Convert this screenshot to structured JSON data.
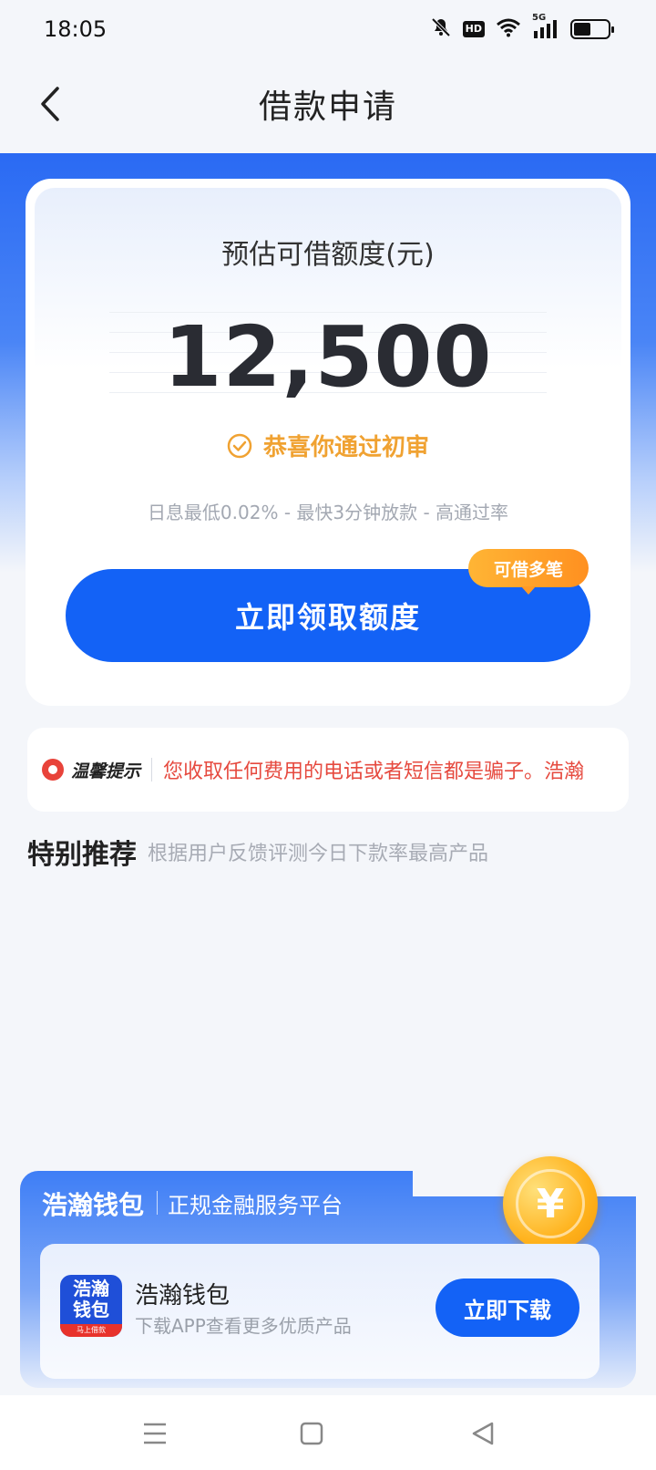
{
  "status_bar": {
    "time": "18:05",
    "hd_label": "HD",
    "network_label": "5G"
  },
  "header": {
    "title": "借款申请"
  },
  "quota": {
    "label": "预估可借额度(元)",
    "amount": "12,500",
    "approval_text": "恭喜你通过初审",
    "features": "日息最低0.02% - 最快3分钟放款 - 高通过率",
    "claim_button": "立即领取额度",
    "tag": "可借多笔"
  },
  "tips": {
    "label": "温馨提示",
    "text": "您收取任何费用的电话或者短信都是骗子。浩瀚"
  },
  "recommend": {
    "title": "特别推荐",
    "subtitle": "根据用户反馈评测今日下款率最高产品"
  },
  "banner": {
    "brand": "浩瀚钱包",
    "slogan": "正规金融服务平台",
    "coin_symbol": "¥",
    "app": {
      "logo_line1": "浩瀚",
      "logo_line2": "钱包",
      "logo_tag": "马上借款",
      "name": "浩瀚钱包",
      "description": "下载APP查看更多优质产品",
      "download_button": "立即下载"
    }
  },
  "colors": {
    "primary": "#1362f6",
    "warning": "#f0a232",
    "danger": "#e64a3f"
  },
  "icons": [
    "back-icon",
    "mute-icon",
    "wifi-icon",
    "signal-icon",
    "battery-icon",
    "check-circle-icon",
    "alert-icon",
    "menu-icon",
    "home-icon",
    "back-triangle-icon"
  ]
}
